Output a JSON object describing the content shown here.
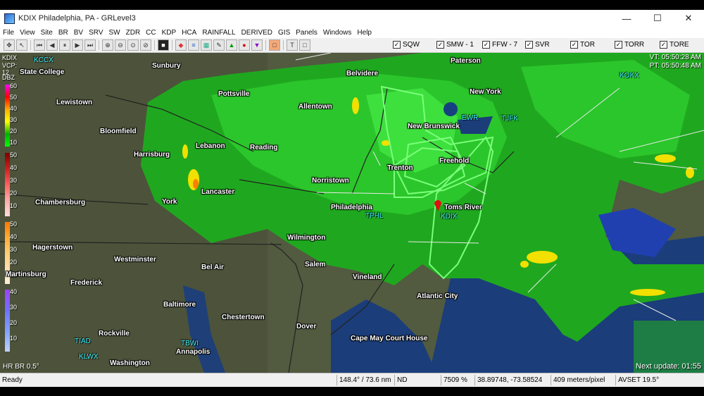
{
  "window": {
    "title": "KDIX Philadelphia, PA - GRLevel3",
    "minimize": "—",
    "maximize": "☐",
    "close": "✕"
  },
  "menu": [
    "File",
    "View",
    "Site",
    "BR",
    "BV",
    "SRV",
    "SW",
    "ZDR",
    "CC",
    "KDP",
    "HCA",
    "RAINFALL",
    "DERIVED",
    "GIS",
    "Panels",
    "Windows",
    "Help"
  ],
  "warnings": [
    {
      "label": "SQW",
      "checked": true
    },
    {
      "label": "SMW - 1",
      "checked": true
    },
    {
      "label": "FFW - 7",
      "checked": true
    },
    {
      "label": "SVR",
      "checked": true
    },
    {
      "label": "TOR",
      "checked": true
    },
    {
      "label": "TORR",
      "checked": true
    },
    {
      "label": "TORE",
      "checked": true
    }
  ],
  "radar": {
    "site": "KDIX",
    "vcp": "VCP: 12",
    "unit": "DBZ",
    "product": "HR BR 0.5°",
    "vol_time": "VT: 05:50:28 AM",
    "plot_time": "PT: 05:50:48 AM",
    "next_update": "Next update: 01:55"
  },
  "legend": {
    "sections": [
      {
        "labels": [
          "60",
          "50",
          "40",
          "30",
          "20",
          "10"
        ],
        "colors": [
          "#ff00ff",
          "#ff0000",
          "#ffaa00",
          "#ffff00",
          "#00b000",
          "#00ff00"
        ]
      },
      {
        "labels": [
          "50",
          "40",
          "30",
          "20",
          "10"
        ],
        "colors": [
          "#7a0000",
          "#cc2020",
          "#ff6060",
          "#ffaaaa",
          "#ffdddd"
        ]
      },
      {
        "labels": [
          "50",
          "40",
          "30",
          "20",
          "10"
        ],
        "colors": [
          "#ff7700",
          "#ffaa33",
          "#ffcc77",
          "#ffe0b0",
          "#fff0dd"
        ]
      },
      {
        "labels": [
          "40",
          "30",
          "20",
          "10"
        ],
        "colors": [
          "#a040ff",
          "#7070ff",
          "#80a0ff",
          "#c0d0ff"
        ]
      }
    ]
  },
  "cities": [
    {
      "name": "State College"
    },
    {
      "name": "Sunbury"
    },
    {
      "name": "Lewistown"
    },
    {
      "name": "Pottsville"
    },
    {
      "name": "Bloomfield"
    },
    {
      "name": "Allentown"
    },
    {
      "name": "Belvidere"
    },
    {
      "name": "Paterson"
    },
    {
      "name": "New York"
    },
    {
      "name": "Harrisburg"
    },
    {
      "name": "Lebanon"
    },
    {
      "name": "Reading"
    },
    {
      "name": "New Brunswick"
    },
    {
      "name": "Freehold"
    },
    {
      "name": "Trenton"
    },
    {
      "name": "Norristown"
    },
    {
      "name": "Chambersburg"
    },
    {
      "name": "York"
    },
    {
      "name": "Lancaster"
    },
    {
      "name": "Philadelphia"
    },
    {
      "name": "Toms River"
    },
    {
      "name": "Hagerstown"
    },
    {
      "name": "Wilmington"
    },
    {
      "name": "Westminster"
    },
    {
      "name": "Bel Air"
    },
    {
      "name": "Salem"
    },
    {
      "name": "Frederick"
    },
    {
      "name": "Vineland"
    },
    {
      "name": "Martinsburg"
    },
    {
      "name": "Atlantic City"
    },
    {
      "name": "Baltimore"
    },
    {
      "name": "Chestertown"
    },
    {
      "name": "Dover"
    },
    {
      "name": "Rockville"
    },
    {
      "name": "Annapolis"
    },
    {
      "name": "Cape May Court House"
    },
    {
      "name": "Washington"
    }
  ],
  "sites": [
    {
      "name": "KCCX"
    },
    {
      "name": "KOKX"
    },
    {
      "name": "EWR"
    },
    {
      "name": "TJFK"
    },
    {
      "name": "TPHL"
    },
    {
      "name": "KDIX"
    },
    {
      "name": "TIAD"
    },
    {
      "name": "KLWX"
    },
    {
      "name": "TBWI"
    }
  ],
  "status": {
    "ready": "Ready",
    "azimuth": "148.4° / 73.6 nm",
    "value": "ND",
    "zoom": "7509 %",
    "coords": "38.89748, -73.58524",
    "resolution": "409 meters/pixel",
    "avset": "AVSET 19.5°"
  }
}
